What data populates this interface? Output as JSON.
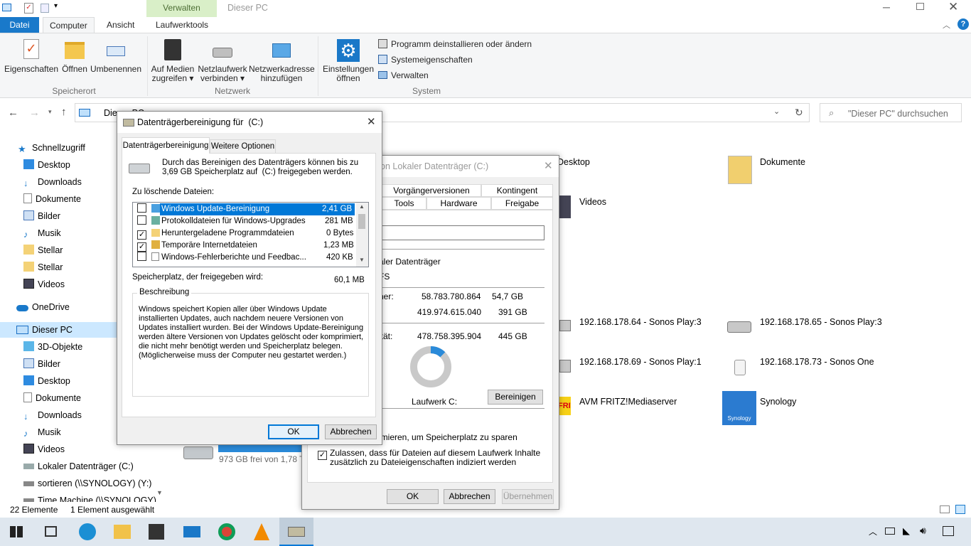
{
  "window": {
    "title": "Dieser PC",
    "context_tab": "Verwalten"
  },
  "ribbon_tabs": [
    "Datei",
    "Computer",
    "Ansicht",
    "Laufwerktools"
  ],
  "ribbon": {
    "groups": [
      "Speicherort",
      "Netzwerk",
      "System"
    ],
    "buttons": [
      {
        "line1": "Eigenschaften",
        "line2": ""
      },
      {
        "line1": "Öffnen",
        "line2": ""
      },
      {
        "line1": "Umbenennen",
        "line2": ""
      },
      {
        "line1": "Auf Medien",
        "line2": "zugreifen ▾"
      },
      {
        "line1": "Netzlaufwerk",
        "line2": "verbinden ▾"
      },
      {
        "line1": "Netzwerkadresse",
        "line2": "hinzufügen"
      },
      {
        "line1": "Einstellungen",
        "line2": "öffnen"
      }
    ],
    "system_items": [
      "Programm deinstallieren oder ändern",
      "Systemeigenschaften",
      "Verwalten"
    ]
  },
  "address": {
    "path": "Dieser PC",
    "search_placeholder": "\"Dieser PC\" durchsuchen"
  },
  "nav": {
    "quick": "Schnellzugriff",
    "quick_items": [
      "Desktop",
      "Downloads",
      "Dokumente",
      "Bilder",
      "Musik",
      "Stellar",
      "Stellar",
      "Videos"
    ],
    "onedrive": "OneDrive",
    "thispc": "Dieser PC",
    "pc_items": [
      "3D-Objekte",
      "Bilder",
      "Desktop",
      "Dokumente",
      "Downloads",
      "Musik",
      "Videos",
      "Lokaler Datenträger (C:)",
      "sortieren (\\\\SYNOLOGY) (Y:)",
      "Time Machine (\\\\SYNOLOGY)"
    ]
  },
  "content": {
    "folders": [
      "Desktop",
      "Dokumente",
      "Videos"
    ],
    "devices": [
      "192.168.178.64 - Sonos Play:3",
      "192.168.178.65 - Sonos Play:3",
      "192.168.178.69 - Sonos Play:1",
      "192.168.178.73 - Sonos One",
      "AVM FRITZ!Mediaserver",
      "Synology"
    ],
    "drive_free": "973 GB frei von 1,78 TB",
    "synology_logo": "Synology",
    "fritz_logo": "FRITZ!"
  },
  "status": {
    "count": "22 Elemente",
    "selected": "1 Element ausgewählt"
  },
  "props": {
    "title": "on Lokaler Datenträger (C:)",
    "tabs_top": [
      "Vorgängerversionen",
      "Kontingent"
    ],
    "tabs_bottom": [
      "Tools",
      "Hardware",
      "Freigabe"
    ],
    "type": "aler Datenträger",
    "fs": "FS",
    "used_label": "her:",
    "used_bytes": "58.783.780.864",
    "used_gb": "54,7 GB",
    "free_label": ":",
    "free_bytes": "419.974.615.040",
    "free_gb": "391 GB",
    "cap_label": "ität:",
    "cap_bytes": "478.758.395.904",
    "cap_gb": "445 GB",
    "used_fraction": 0.123,
    "drive_label": "Laufwerk C:",
    "clean_btn": "Bereinigen",
    "compress": "imieren, um Speicherplatz zu sparen",
    "index1": "Zulassen, dass für Dateien auf diesem Laufwerk Inhalte",
    "index2": "zusätzlich zu Dateieigenschaften indiziert werden",
    "ok": "OK",
    "cancel": "Abbrechen",
    "apply": "Übernehmen"
  },
  "cleanup": {
    "title": "Datenträgerbereinigung für  (C:)",
    "tabs": [
      "Datenträgerbereinigung",
      "Weitere Optionen"
    ],
    "intro1": "Durch das Bereinigen des Datenträgers können bis zu",
    "intro2": "3,69 GB Speicherplatz auf  (C:) freigegeben werden.",
    "list_label": "Zu löschende Dateien:",
    "files": [
      {
        "name": "Windows Update-Bereinigung",
        "size": "2,41 GB",
        "checked": false
      },
      {
        "name": "Protokolldateien für Windows-Upgrades",
        "size": "281 MB",
        "checked": false
      },
      {
        "name": "Heruntergeladene Programmdateien",
        "size": "0 Bytes",
        "checked": true
      },
      {
        "name": "Temporäre Internetdateien",
        "size": "1,23 MB",
        "checked": true
      },
      {
        "name": "Windows-Fehlerberichte und Feedbac...",
        "size": "420 KB",
        "checked": false
      }
    ],
    "space_label": "Speicherplatz, der freigegeben wird:",
    "space_value": "60,1 MB",
    "desc_label": "Beschreibung",
    "desc_lines": [
      "Windows speichert Kopien aller über Windows Update",
      "installierten Updates, auch nachdem neuere Versionen von",
      "Updates installiert wurden. Bei der Windows Update-Bereinigung",
      "werden ältere Versionen von Updates gelöscht oder komprimiert,",
      "die nicht mehr benötigt werden und Speicherplatz belegen.",
      "(Möglicherweise muss der Computer neu gestartet werden.)"
    ],
    "ok": "OK",
    "cancel": "Abbrechen"
  },
  "colors": {
    "accent": "#0078d7",
    "select": "#0078d7",
    "ribbon_context": "#d3edc0"
  }
}
